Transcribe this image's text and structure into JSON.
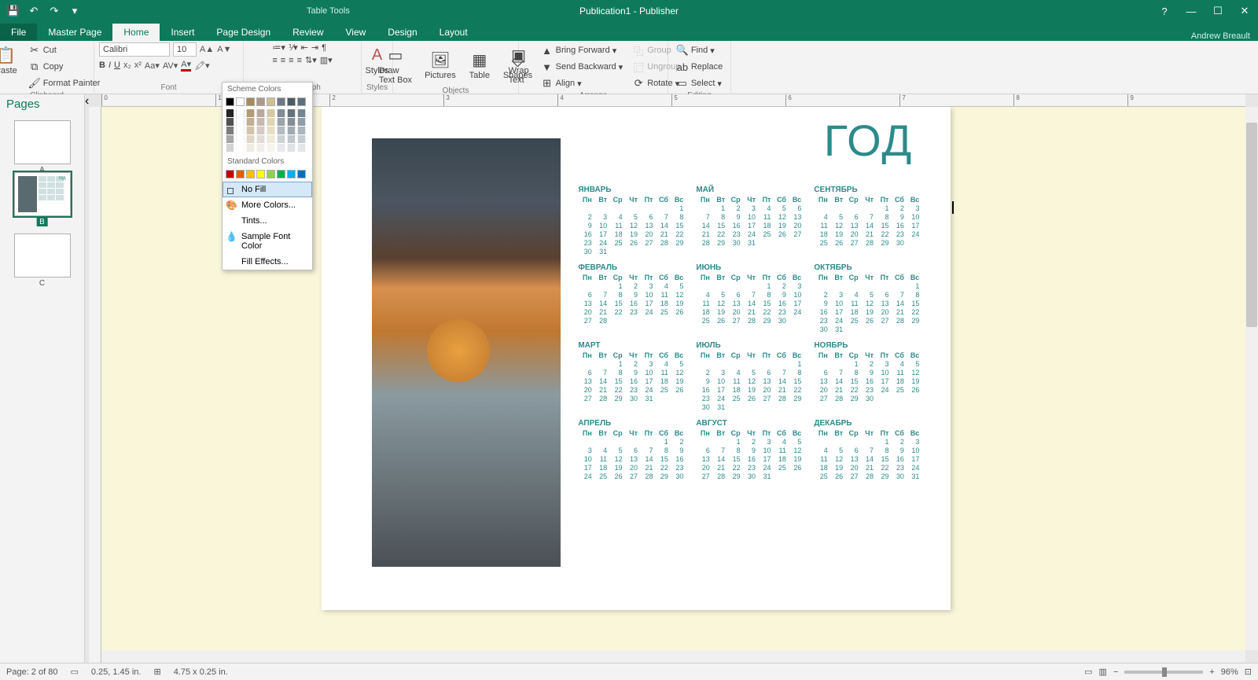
{
  "titlebar": {
    "tools": "Table Tools",
    "doc": "Publication1 - Publisher"
  },
  "tabs": {
    "file": "File",
    "masterpage": "Master Page",
    "home": "Home",
    "insert": "Insert",
    "pagedesign": "Page Design",
    "review": "Review",
    "view": "View",
    "design": "Design",
    "layout": "Layout",
    "user": "Andrew Breault"
  },
  "ribbon": {
    "paste": "Paste",
    "cut": "Cut",
    "copy": "Copy",
    "formatpainter": "Format Painter",
    "clipboard": "Clipboard",
    "fontname": "Calibri",
    "fontsize": "10",
    "font": "Font",
    "paragraph": "Paragraph",
    "styles_btn": "Styles",
    "styles": "Styles",
    "drawtextbox": "Draw\nText Box",
    "pictures": "Pictures",
    "table": "Table",
    "shapes": "Shapes",
    "objects": "Objects",
    "wraptext": "Wrap\nText",
    "bringforward": "Bring Forward",
    "sendbackward": "Send Backward",
    "align": "Align",
    "group": "Group",
    "ungroup": "Ungroup",
    "rotate": "Rotate",
    "arrange": "Arrange",
    "find": "Find",
    "replace": "Replace",
    "select": "Select",
    "editing": "Editing"
  },
  "colormenu": {
    "scheme": "Scheme Colors",
    "standard": "Standard Colors",
    "nofill": "No Fill",
    "more": "More Colors...",
    "tints": "Tints...",
    "sample": "Sample Font Color",
    "effects": "Fill Effects...",
    "scheme_row": [
      "#000000",
      "#ffffff",
      "#a68a5c",
      "#b0988c",
      "#d0c090",
      "#6b7a84",
      "#4a5a66",
      "#5a7080"
    ],
    "standard_row": [
      "#c00000",
      "#e06000",
      "#ffc000",
      "#ffff00",
      "#92d050",
      "#00b050",
      "#00b0f0",
      "#0070c0"
    ]
  },
  "pages": {
    "title": "Pages",
    "a": "A",
    "b": "B",
    "c": "C"
  },
  "document": {
    "year": "ГОД",
    "dayheaders": [
      "Пн",
      "Вт",
      "Ср",
      "Чт",
      "Пт",
      "Сб",
      "Вс"
    ],
    "months": [
      {
        "name": "ЯНВАРЬ",
        "start": 6,
        "len": 31
      },
      {
        "name": "МАЙ",
        "start": 1,
        "len": 31
      },
      {
        "name": "СЕНТЯБРЬ",
        "start": 4,
        "len": 30
      },
      {
        "name": "ФЕВРАЛЬ",
        "start": 2,
        "len": 28
      },
      {
        "name": "ИЮНЬ",
        "start": 4,
        "len": 30
      },
      {
        "name": "ОКТЯБРЬ",
        "start": 6,
        "len": 31
      },
      {
        "name": "МАРТ",
        "start": 2,
        "len": 31
      },
      {
        "name": "ИЮЛЬ",
        "start": 6,
        "len": 31
      },
      {
        "name": "НОЯБРЬ",
        "start": 2,
        "len": 30
      },
      {
        "name": "АПРЕЛЬ",
        "start": 5,
        "len": 30
      },
      {
        "name": "АВГУСТ",
        "start": 2,
        "len": 31
      },
      {
        "name": "ДЕКАБРЬ",
        "start": 4,
        "len": 31
      }
    ]
  },
  "ruler": [
    "0",
    "1",
    "2",
    "3",
    "4",
    "5",
    "6",
    "7",
    "8",
    "9"
  ],
  "status": {
    "page": "Page: 2 of 80",
    "pos": "0.25, 1.45 in.",
    "size": "4.75 x 0.25 in.",
    "zoom": "96%"
  }
}
